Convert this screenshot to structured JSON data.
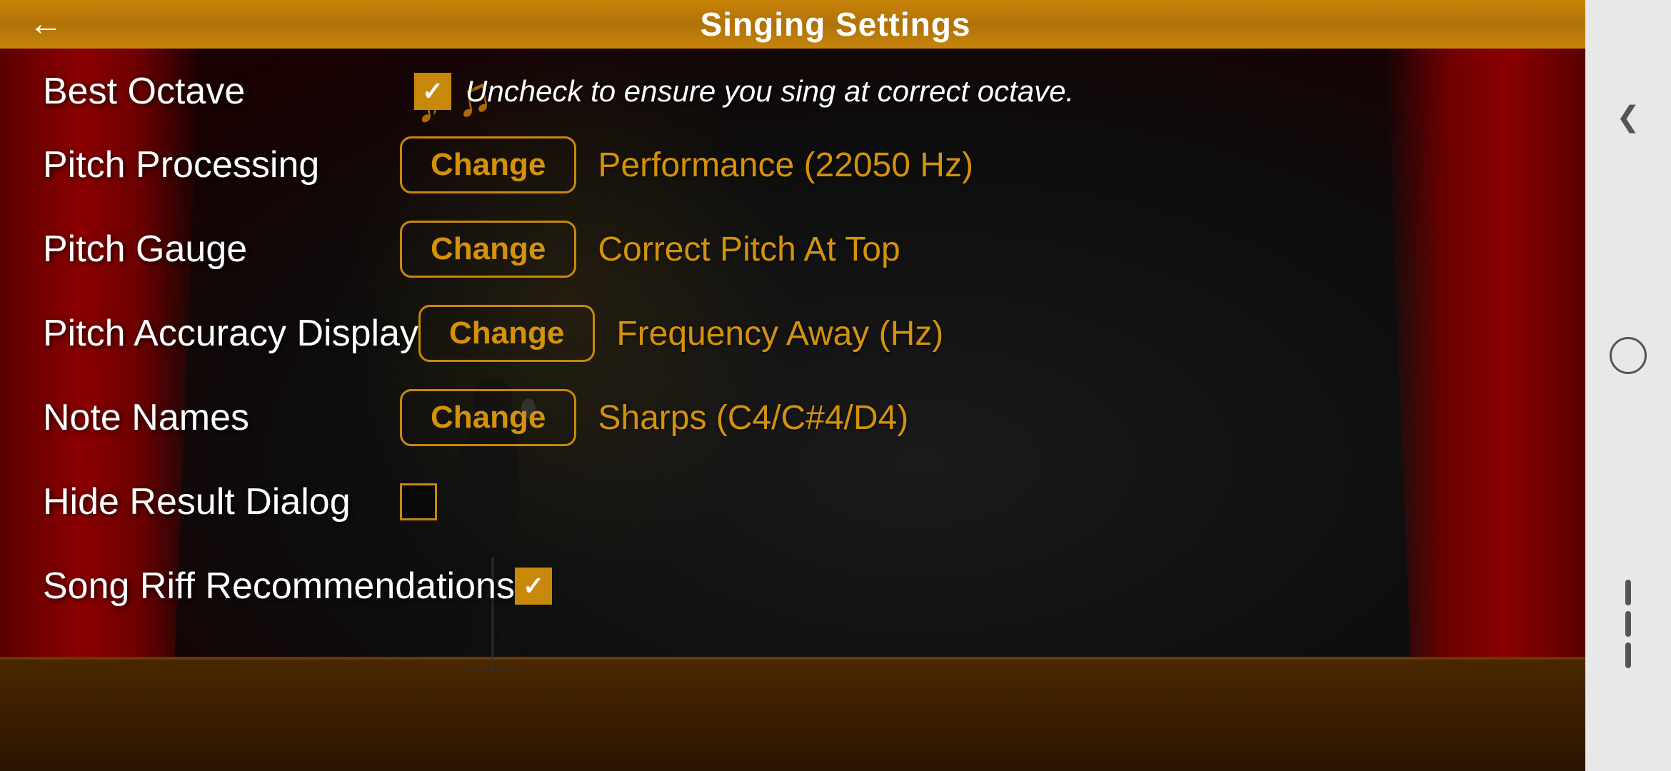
{
  "header": {
    "title": "Singing Settings",
    "back_label": "←"
  },
  "settings": {
    "best_octave": {
      "label": "Best Octave",
      "checked": true,
      "description": "Uncheck to ensure you sing at correct octave."
    },
    "pitch_processing": {
      "label": "Pitch Processing",
      "button_label": "Change",
      "value": "Performance (22050 Hz)"
    },
    "pitch_gauge": {
      "label": "Pitch Gauge",
      "button_label": "Change",
      "value": "Correct Pitch At Top"
    },
    "pitch_accuracy_display": {
      "label": "Pitch Accuracy Display",
      "button_label": "Change",
      "value": "Frequency Away (Hz)"
    },
    "note_names": {
      "label": "Note Names",
      "button_label": "Change",
      "value": "Sharps (C4/C#4/D4)"
    },
    "hide_result_dialog": {
      "label": "Hide Result Dialog",
      "checked": false
    },
    "song_riff_recommendations": {
      "label": "Song Riff Recommendations",
      "checked": true
    }
  },
  "navbar": {
    "chevron": "❮"
  }
}
